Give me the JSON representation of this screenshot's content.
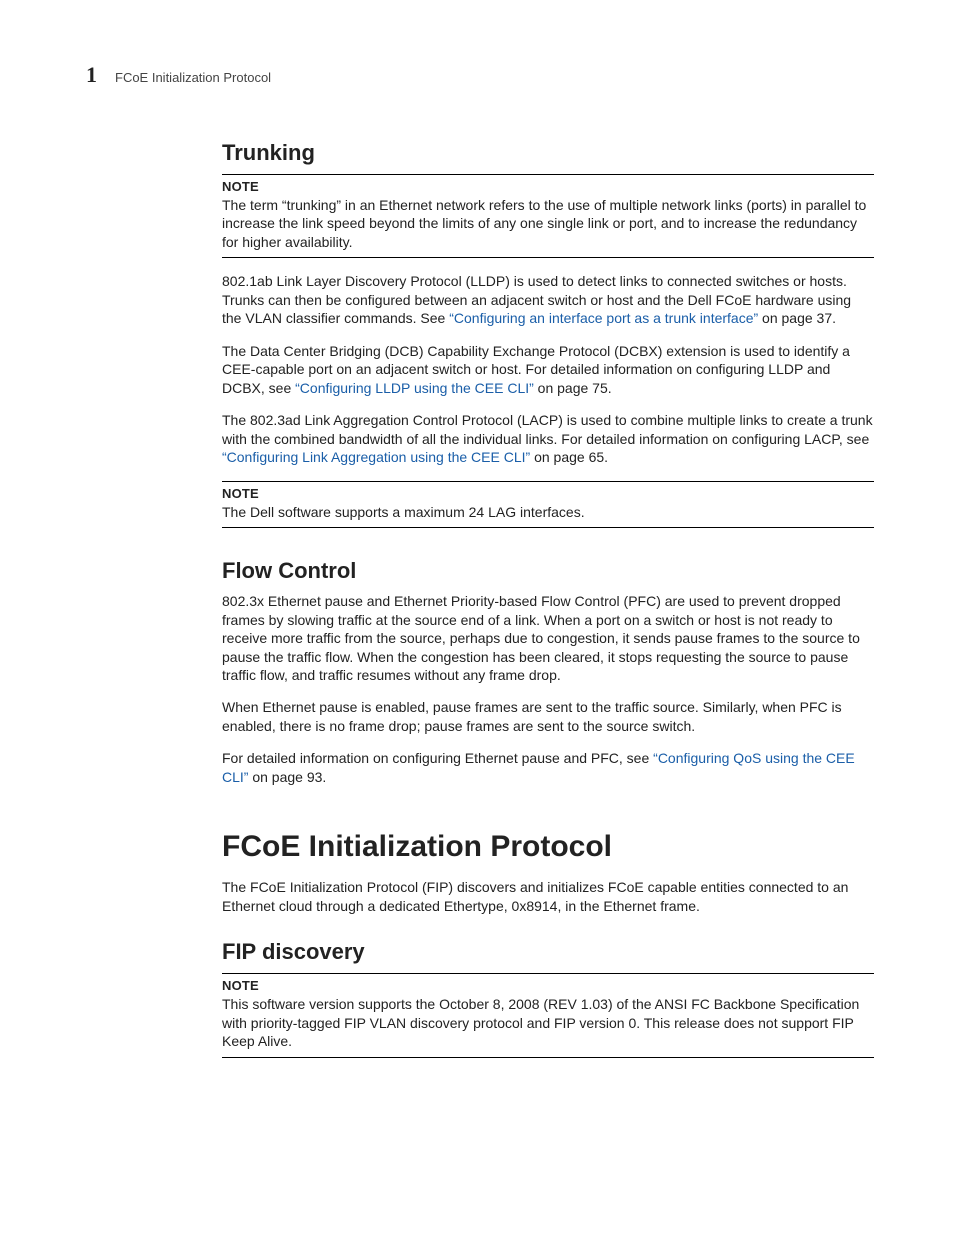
{
  "header": {
    "chapter_number": "1",
    "running_title": "FCoE Initialization Protocol"
  },
  "trunking": {
    "heading": "Trunking",
    "note1_label": "NOTE",
    "note1_body": "The term “trunking” in an Ethernet network refers to the use of multiple network links (ports) in parallel to increase the link speed beyond the limits of any one single link or port, and to increase the redundancy for higher availability.",
    "p1_a": "802.1ab Link Layer Discovery Protocol (LLDP) is used to detect links to connected switches or hosts. Trunks can then be configured between an adjacent switch or host and the Dell FCoE hardware using the VLAN classifier commands. See ",
    "p1_link": "“Configuring an interface port as a trunk interface”",
    "p1_b": " on page 37.",
    "p2_a": "The Data Center Bridging (DCB) Capability Exchange Protocol (DCBX) extension is used to identify a CEE-capable port on an adjacent switch or host. For detailed information on configuring LLDP and DCBX, see ",
    "p2_link": "“Configuring LLDP using the CEE CLI”",
    "p2_b": " on page 75.",
    "p3_a": "The 802.3ad Link Aggregation Control Protocol (LACP) is used to combine multiple links to create a trunk with the combined bandwidth of all the individual links. For detailed information on configuring LACP, see ",
    "p3_link": "“Configuring Link Aggregation using the CEE CLI”",
    "p3_b": " on page 65.",
    "note2_label": "NOTE",
    "note2_body": "The Dell software supports a maximum 24 LAG interfaces."
  },
  "flow": {
    "heading": "Flow Control",
    "p1": "802.3x Ethernet pause and Ethernet Priority-based Flow Control (PFC) are used to prevent dropped frames by slowing traffic at the source end of a link. When a port on a switch or host is not ready to receive more traffic from the source, perhaps due to congestion, it sends pause frames to the source to pause the traffic flow. When the congestion has been cleared, it stops requesting the source to pause traffic flow, and traffic resumes without any frame drop.",
    "p2": "When Ethernet pause is enabled, pause frames are sent to the traffic source. Similarly, when PFC is enabled, there is no frame drop; pause frames are sent to the source switch.",
    "p3_a": "For detailed information on configuring Ethernet pause and PFC, see ",
    "p3_link": "“Configuring QoS using the CEE CLI”",
    "p3_b": " on page 93."
  },
  "fip": {
    "heading": "FCoE Initialization Protocol",
    "intro": "The FCoE Initialization Protocol (FIP) discovers and initializes FCoE capable entities connected to an Ethernet cloud through a dedicated Ethertype, 0x8914, in the Ethernet frame.",
    "sub_heading": "FIP discovery",
    "note_label": "NOTE",
    "note_body": "This software version supports the October 8, 2008 (REV 1.03) of the ANSI FC Backbone Specification with priority-tagged FIP VLAN discovery protocol and FIP version 0. This release does not support FIP Keep Alive."
  }
}
